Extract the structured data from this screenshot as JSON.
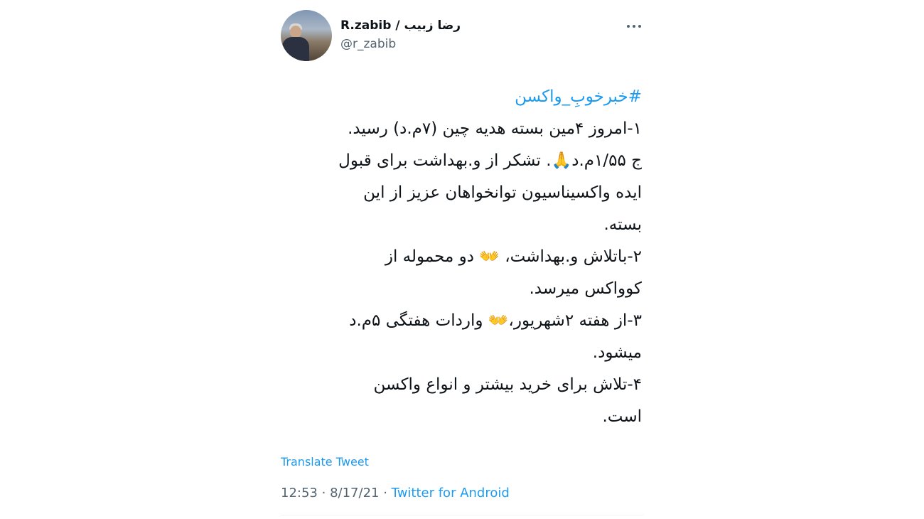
{
  "author": {
    "display_name": "R.zabib / رضا زبیب",
    "handle": "@r_zabib",
    "avatar_icon": "profile-photo"
  },
  "more_icon": "more-dots-icon",
  "tweet": {
    "hashtag": "#خبرخوبِ_واکسن",
    "lines": [
      "۱-امروز ۴مین بسته هدیه چین (۷م.د) رسید.",
      "ج ۱/۵۵م.د🙏. تشکر از و.بهداشت برای قبول",
      "ایده واکسیناسیون توانخواهان عزیز از این",
      "بسته.",
      "۲-باتلاش و.بهداشت، 👐 دو محموله از",
      "کوواکس میرسد.",
      "۳-از هفته ۲شهریور،👐 واردات هفتگی ۵م.د",
      "میشود.",
      "۴-تلاش برای خرید بیشتر و انواع واکسن",
      "است."
    ]
  },
  "translate_label": "Translate Tweet",
  "meta": {
    "time": "12:53",
    "date": "8/17/21",
    "separator": "·",
    "source": "Twitter for Android"
  },
  "colors": {
    "link": "#1d9bf0",
    "text": "#0f1419",
    "muted": "#536471"
  }
}
